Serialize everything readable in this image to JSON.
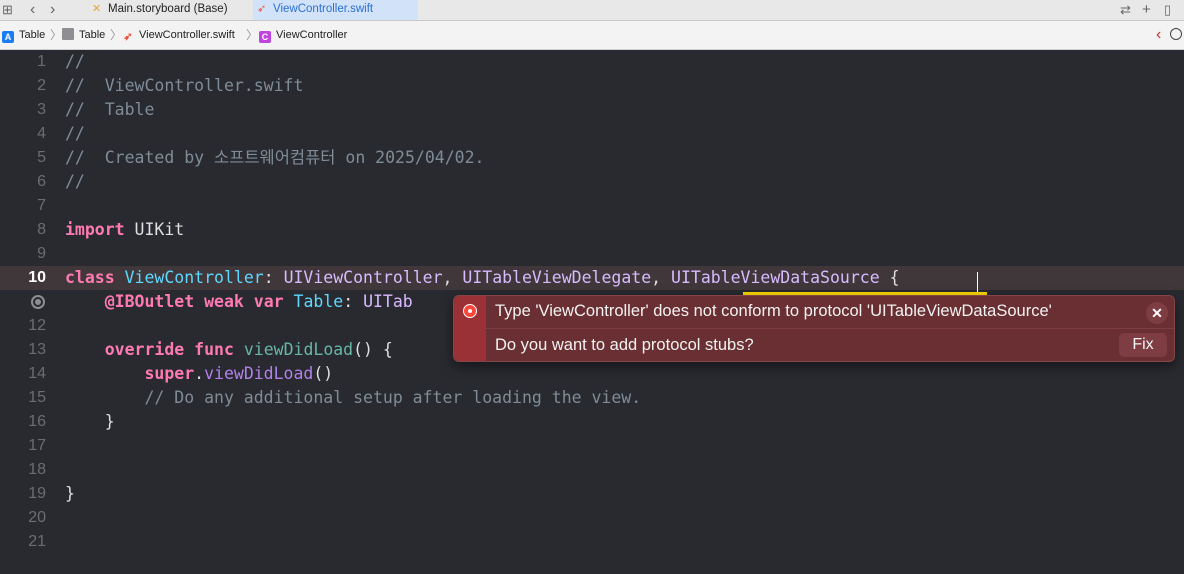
{
  "tabbar": {
    "tabs": [
      {
        "label": "Main.storyboard (Base)",
        "icon": "storyboard-icon"
      },
      {
        "label": "ViewController.swift",
        "icon": "swift-icon",
        "active": true
      }
    ],
    "accent": "#2a6fd8"
  },
  "jumpbar": {
    "crumbs": [
      {
        "label": "Table",
        "icon": "app-icon"
      },
      {
        "label": "Table",
        "icon": "folder-icon"
      },
      {
        "label": "ViewController.swift",
        "icon": "swift-icon"
      },
      {
        "label": "ViewController",
        "icon": "class-c-icon",
        "badge": "C"
      }
    ]
  },
  "editor": {
    "current_line": "10",
    "lines": [
      {
        "n": "1",
        "t1": "//"
      },
      {
        "n": "2",
        "t1": "//  ViewController.swift"
      },
      {
        "n": "3",
        "t1": "//  Table"
      },
      {
        "n": "4",
        "t1": "//"
      },
      {
        "n": "5",
        "t1": "//  Created by 소프트웨어컴퓨터 on 2025/04/02."
      },
      {
        "n": "6",
        "t1": "//"
      },
      {
        "n": "7",
        "t1": ""
      },
      {
        "n": "8",
        "t1": "import",
        "t2": " UIKit"
      },
      {
        "n": "9",
        "t1": ""
      },
      {
        "n": "10",
        "t1": "class",
        "t2": " ",
        "t3": "ViewController",
        "t4": ": ",
        "t5": "UIViewController",
        "t6": ", ",
        "t7": "UITableViewDelegate",
        "t8": ", ",
        "t9": "UITableViewDataSource",
        "t10": " {"
      },
      {
        "n": "",
        "t1": "    @IBOutlet",
        "t2": " ",
        "t3": "weak",
        "t4": " ",
        "t5": "var",
        "t6": " ",
        "t7": "Table",
        "t8": ": ",
        "t9": "UITab"
      },
      {
        "n": "12",
        "t1": ""
      },
      {
        "n": "13",
        "t1": "    override",
        "t2": " ",
        "t3": "func",
        "t4": " ",
        "t5": "viewDidLoad",
        "t6": "() {"
      },
      {
        "n": "14",
        "t1": "        super",
        "t2": ".",
        "t3": "viewDidLoad",
        "t4": "()"
      },
      {
        "n": "15",
        "t1": "        // Do any additional setup after loading the view."
      },
      {
        "n": "16",
        "t1": "    }"
      },
      {
        "n": "17",
        "t1": ""
      },
      {
        "n": "18",
        "t1": ""
      },
      {
        "n": "19",
        "t1": "}"
      },
      {
        "n": "20",
        "t1": ""
      },
      {
        "n": "21",
        "t1": ""
      }
    ]
  },
  "error_popup": {
    "message": "Type 'ViewController' does not conform to protocol 'UITableViewDataSource'",
    "question": "Do you want to add protocol stubs?",
    "close_label": "✕",
    "fix_label": "Fix",
    "color": "#ff453a"
  },
  "toolbar_icons": {
    "grid": "⊞",
    "back": "‹",
    "forward": "›",
    "swap": "⇄",
    "add": "+",
    "split": "▯",
    "jump_back": "‹"
  }
}
